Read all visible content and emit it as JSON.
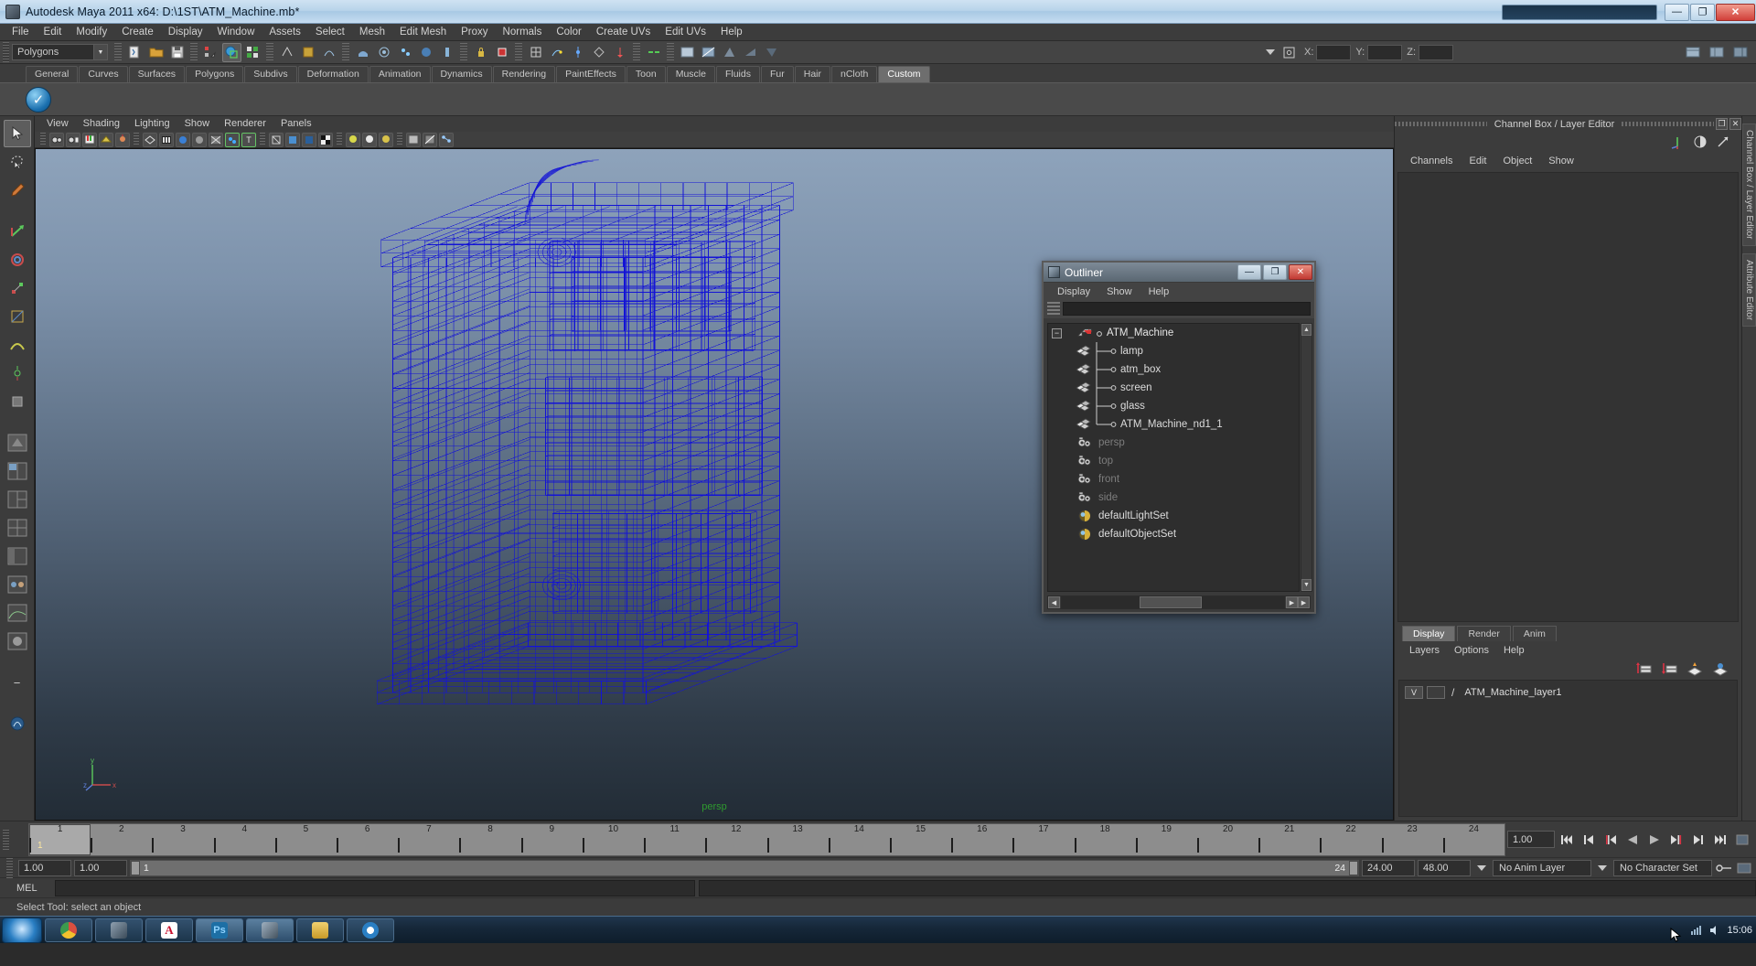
{
  "window": {
    "title": "Autodesk Maya 2011 x64: D:\\1ST\\ATM_Machine.mb*",
    "minimize": "—",
    "maximize": "❐",
    "close": "✕"
  },
  "menubar": {
    "items": [
      "File",
      "Edit",
      "Modify",
      "Create",
      "Display",
      "Window",
      "Assets",
      "Select",
      "Mesh",
      "Edit Mesh",
      "Proxy",
      "Normals",
      "Color",
      "Create UVs",
      "Edit UVs",
      "Help"
    ]
  },
  "statusline": {
    "mode_selector": "Polygons",
    "coord_labels": {
      "x": "X:",
      "y": "Y:",
      "z": "Z:"
    },
    "coord_values": {
      "x": "",
      "y": "",
      "z": ""
    },
    "icons": [
      "new-scene-icon",
      "open-scene-icon",
      "save-scene-icon",
      "select-by-hierarchy-icon",
      "select-by-object-icon",
      "select-by-component-icon",
      "select-handle-icon",
      "select-joint-icon",
      "select-curve-icon",
      "select-surface-icon",
      "select-deformation-icon",
      "select-dynamic-icon",
      "select-rendering-icon",
      "select-misc-icon",
      "lock-icon",
      "highlight-icon",
      "snap-grid-icon",
      "snap-curve-icon",
      "snap-point-icon",
      "snap-view-plane-icon",
      "snap-normal-icon",
      "construction-history-icon",
      "render-icon",
      "ipr-render-icon",
      "render-settings-icon",
      "open-attribute-editor-icon",
      "open-tool-settings-icon",
      "open-channel-box-icon"
    ]
  },
  "shelf": {
    "tabs": [
      "General",
      "Curves",
      "Surfaces",
      "Polygons",
      "Subdivs",
      "Deformation",
      "Animation",
      "Dynamics",
      "Rendering",
      "PaintEffects",
      "Toon",
      "Muscle",
      "Fluids",
      "Fur",
      "Hair",
      "nCloth",
      "Custom"
    ],
    "active_tab": "Custom",
    "buttons": [
      "check-circle-icon"
    ]
  },
  "toolbox": {
    "tools": [
      "select-tool",
      "lasso-select-tool",
      "paint-select-tool",
      "move-tool",
      "rotate-tool",
      "scale-tool",
      "universal-manipulator-tool",
      "soft-modification-tool",
      "show-manipulator-tool",
      "last-tool",
      "view-cube-icon",
      "layout-single-icon",
      "layout-two-pane-icon",
      "layout-three-pane-icon",
      "layout-four-pane-icon",
      "layout-persp-outliner-icon",
      "layout-hypergraph-icon",
      "layout-persp-graph-icon",
      "layout-hypershade-icon",
      "layout-quick-icon"
    ],
    "selected": "select-tool"
  },
  "viewport": {
    "menu": [
      "View",
      "Shading",
      "Lighting",
      "Show",
      "Renderer",
      "Panels"
    ],
    "toolbar_icons": [
      "select-camera-icon",
      "camera-attributes-icon",
      "bookmark-icon",
      "image-plane-icon",
      "two-sided-lighting-icon",
      "wireframe-icon",
      "smooth-shade-icon",
      "flat-shade-icon",
      "shaded-textured-icon",
      "wireframe-on-shaded-icon",
      "xray-icon",
      "xray-joints-icon",
      "hardware-texturing-icon",
      "hardware-lighting-icon",
      "shadows-icon",
      "high-quality-render-icon",
      "isolate-select-icon",
      "ipr-region-icon",
      "grid-icon"
    ],
    "camera_label": "persp",
    "axis_labels": {
      "x": "x",
      "y": "y",
      "z": "z"
    },
    "model_name": "ATM_Machine wireframe",
    "wireframe_color": "#1313d6",
    "background_top": "#8ea3bb",
    "background_bottom": "#222c36"
  },
  "outliner": {
    "title": "Outliner",
    "menu": [
      "Display",
      "Show",
      "Help"
    ],
    "search_value": "",
    "window_buttons": {
      "minimize": "—",
      "maximize": "❐",
      "close": "✕"
    },
    "items": [
      {
        "label": "ATM_Machine",
        "icon": "transform-group-icon",
        "indent": 0,
        "dim": false,
        "expander": "−",
        "connector": "none"
      },
      {
        "label": "lamp",
        "icon": "mesh-icon",
        "indent": 1,
        "dim": false,
        "expander": "",
        "connector": "tee"
      },
      {
        "label": "atm_box",
        "icon": "mesh-icon",
        "indent": 1,
        "dim": false,
        "expander": "",
        "connector": "tee"
      },
      {
        "label": "screen",
        "icon": "mesh-icon",
        "indent": 1,
        "dim": false,
        "expander": "",
        "connector": "tee"
      },
      {
        "label": "glass",
        "icon": "mesh-icon",
        "indent": 1,
        "dim": false,
        "expander": "",
        "connector": "tee"
      },
      {
        "label": "ATM_Machine_nd1_1",
        "icon": "mesh-icon",
        "indent": 1,
        "dim": false,
        "expander": "",
        "connector": "elbow"
      },
      {
        "label": "persp",
        "icon": "camera-icon",
        "indent": 0,
        "dim": true,
        "expander": "",
        "connector": "none"
      },
      {
        "label": "top",
        "icon": "camera-icon",
        "indent": 0,
        "dim": true,
        "expander": "",
        "connector": "none"
      },
      {
        "label": "front",
        "icon": "camera-icon",
        "indent": 0,
        "dim": true,
        "expander": "",
        "connector": "none"
      },
      {
        "label": "side",
        "icon": "camera-icon",
        "indent": 0,
        "dim": true,
        "expander": "",
        "connector": "none"
      },
      {
        "label": "defaultLightSet",
        "icon": "set-icon",
        "indent": 0,
        "dim": false,
        "expander": "",
        "connector": "none"
      },
      {
        "label": "defaultObjectSet",
        "icon": "set-icon",
        "indent": 0,
        "dim": false,
        "expander": "",
        "connector": "none"
      }
    ]
  },
  "channelbox": {
    "title": "Channel Box / Layer Editor",
    "menu": [
      "Channels",
      "Edit",
      "Object",
      "Show"
    ],
    "header_icons": [
      "channel-box-toggle-icon",
      "attribute-editor-toggle-icon",
      "tool-settings-toggle-icon"
    ],
    "window_buttons": {
      "restore": "❐",
      "close": "✕"
    },
    "vertical_tabs": [
      "Channel Box / Layer Editor",
      "Attribute Editor"
    ],
    "content": ""
  },
  "layer_editor": {
    "tabs": [
      "Display",
      "Render",
      "Anim"
    ],
    "active_tab": "Display",
    "menu": [
      "Layers",
      "Options",
      "Help"
    ],
    "toolbar_icons": [
      "move-layer-up-icon",
      "move-layer-down-icon",
      "new-layer-icon",
      "new-layer-from-selected-icon"
    ],
    "layers": [
      {
        "visibility": "V",
        "playback": "",
        "type_marker": "/",
        "name": "ATM_Machine_layer1"
      }
    ]
  },
  "timeslider": {
    "ticks": [
      "1",
      "2",
      "3",
      "4",
      "5",
      "6",
      "7",
      "8",
      "9",
      "10",
      "11",
      "12",
      "13",
      "14",
      "15",
      "16",
      "17",
      "18",
      "19",
      "20",
      "21",
      "22",
      "23",
      "24"
    ],
    "current_frame_label": "1",
    "current_time_field": "1.00",
    "playback_icons": [
      "go-to-start-icon",
      "step-back-frame-icon",
      "step-back-key-icon",
      "play-backwards-icon",
      "play-forwards-icon",
      "step-forward-key-icon",
      "step-forward-frame-icon",
      "go-to-end-icon"
    ]
  },
  "rangeslider": {
    "start_field": "1.00",
    "end_field": "1.00",
    "range_start_label": "1",
    "range_end_label": "24",
    "playback_start": "24.00",
    "playback_end": "48.00",
    "anim_layer": "No Anim Layer",
    "character_set": "No Character Set",
    "auto_key_icon": "key-icon",
    "anim_prefs_icon": "animation-preferences-icon"
  },
  "commandline": {
    "label": "MEL",
    "input_value": "",
    "output_value": ""
  },
  "helpline": {
    "text": "Select Tool: select an object"
  },
  "taskbar": {
    "start_label": "Start",
    "items": [
      "chrome-icon",
      "maya-icon",
      "adobe-reader-icon",
      "photoshop-icon",
      "maya-icon",
      "explorer-icon",
      "chrome-icon"
    ],
    "clock": "15:06",
    "tray_icons": [
      "network-icon",
      "volume-icon",
      "action-center-icon"
    ]
  }
}
